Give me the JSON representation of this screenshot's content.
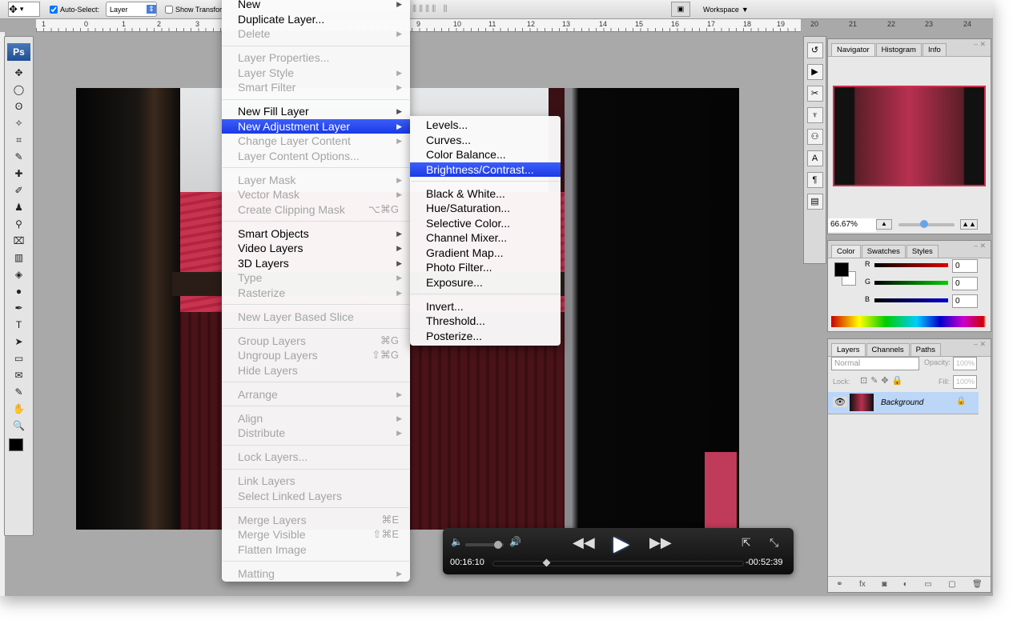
{
  "options_bar": {
    "auto_select_label": "Auto-Select:",
    "auto_select_checked": true,
    "auto_select_value": "Layer",
    "show_transform_label": "Show Transfor",
    "workspace_label": "Workspace"
  },
  "ruler": {
    "labels": [
      "1",
      "0",
      "1",
      "2",
      "3",
      "9",
      "10",
      "11",
      "12",
      "13",
      "14",
      "15",
      "16",
      "17",
      "18",
      "19",
      "20",
      "21",
      "22",
      "23",
      "24"
    ]
  },
  "app_badge": "Ps",
  "layer_menu": {
    "items": [
      {
        "label": "New",
        "arrow": true
      },
      {
        "label": "Duplicate Layer..."
      },
      {
        "label": "Delete",
        "disabled": true,
        "arrow": true
      },
      {
        "sep": true
      },
      {
        "label": "Layer Properties...",
        "disabled": true
      },
      {
        "label": "Layer Style",
        "disabled": true,
        "arrow": true
      },
      {
        "label": "Smart Filter",
        "disabled": true,
        "arrow": true
      },
      {
        "sep": true
      },
      {
        "label": "New Fill Layer",
        "arrow": true
      },
      {
        "label": "New Adjustment Layer",
        "arrow": true,
        "highlighted": true
      },
      {
        "label": "Change Layer Content",
        "disabled": true,
        "arrow": true
      },
      {
        "label": "Layer Content Options...",
        "disabled": true
      },
      {
        "sep": true
      },
      {
        "label": "Layer Mask",
        "disabled": true,
        "arrow": true
      },
      {
        "label": "Vector Mask",
        "disabled": true,
        "arrow": true
      },
      {
        "label": "Create Clipping Mask",
        "disabled": true,
        "shortcut": "⌥⌘G"
      },
      {
        "sep": true
      },
      {
        "label": "Smart Objects",
        "arrow": true
      },
      {
        "label": "Video Layers",
        "arrow": true
      },
      {
        "label": "3D Layers",
        "arrow": true
      },
      {
        "label": "Type",
        "disabled": true,
        "arrow": true
      },
      {
        "label": "Rasterize",
        "disabled": true,
        "arrow": true
      },
      {
        "sep": true
      },
      {
        "label": "New Layer Based Slice",
        "disabled": true
      },
      {
        "sep": true
      },
      {
        "label": "Group Layers",
        "disabled": true,
        "shortcut": "⌘G"
      },
      {
        "label": "Ungroup Layers",
        "disabled": true,
        "shortcut": "⇧⌘G"
      },
      {
        "label": "Hide Layers",
        "disabled": true
      },
      {
        "sep": true
      },
      {
        "label": "Arrange",
        "disabled": true,
        "arrow": true
      },
      {
        "sep": true
      },
      {
        "label": "Align",
        "disabled": true,
        "arrow": true
      },
      {
        "label": "Distribute",
        "disabled": true,
        "arrow": true
      },
      {
        "sep": true
      },
      {
        "label": "Lock Layers...",
        "disabled": true
      },
      {
        "sep": true
      },
      {
        "label": "Link Layers",
        "disabled": true
      },
      {
        "label": "Select Linked Layers",
        "disabled": true
      },
      {
        "sep": true
      },
      {
        "label": "Merge Layers",
        "disabled": true,
        "shortcut": "⌘E"
      },
      {
        "label": "Merge Visible",
        "disabled": true,
        "shortcut": "⇧⌘E"
      },
      {
        "label": "Flatten Image",
        "disabled": true
      },
      {
        "sep": true
      },
      {
        "label": "Matting",
        "disabled": true,
        "arrow": true
      }
    ]
  },
  "adjustment_submenu": {
    "items": [
      {
        "label": "Levels..."
      },
      {
        "label": "Curves..."
      },
      {
        "label": "Color Balance..."
      },
      {
        "label": "Brightness/Contrast...",
        "highlighted": true
      },
      {
        "sep": true
      },
      {
        "label": "Black & White..."
      },
      {
        "label": "Hue/Saturation..."
      },
      {
        "label": "Selective Color..."
      },
      {
        "label": "Channel Mixer..."
      },
      {
        "label": "Gradient Map..."
      },
      {
        "label": "Photo Filter..."
      },
      {
        "label": "Exposure..."
      },
      {
        "sep": true
      },
      {
        "label": "Invert..."
      },
      {
        "label": "Threshold..."
      },
      {
        "label": "Posterize..."
      }
    ]
  },
  "navigator": {
    "tabs": [
      "Navigator",
      "Histogram",
      "Info"
    ],
    "zoom": "66.67%",
    "zoom_slider_fraction": 0.45
  },
  "color": {
    "tabs": [
      "Color",
      "Swatches",
      "Styles"
    ],
    "channels": [
      {
        "label": "R",
        "value": "0",
        "color": "#e00000"
      },
      {
        "label": "G",
        "value": "0",
        "color": "#00d000"
      },
      {
        "label": "B",
        "value": "0",
        "color": "#0000d0"
      }
    ],
    "foreground": "#000000",
    "background": "#ffffff"
  },
  "layers": {
    "tabs": [
      "Layers",
      "Channels",
      "Paths"
    ],
    "blend_mode": "Normal",
    "opacity_label": "Opacity:",
    "opacity": "100%",
    "lock_label": "Lock:",
    "fill_label": "Fill:",
    "fill": "100%",
    "items": [
      {
        "name": "Background",
        "locked": true,
        "visible": true
      }
    ]
  },
  "video": {
    "elapsed": "00:16:10",
    "remaining": "-00:52:39",
    "progress_fraction": 0.2,
    "volume_fraction": 0.85
  }
}
